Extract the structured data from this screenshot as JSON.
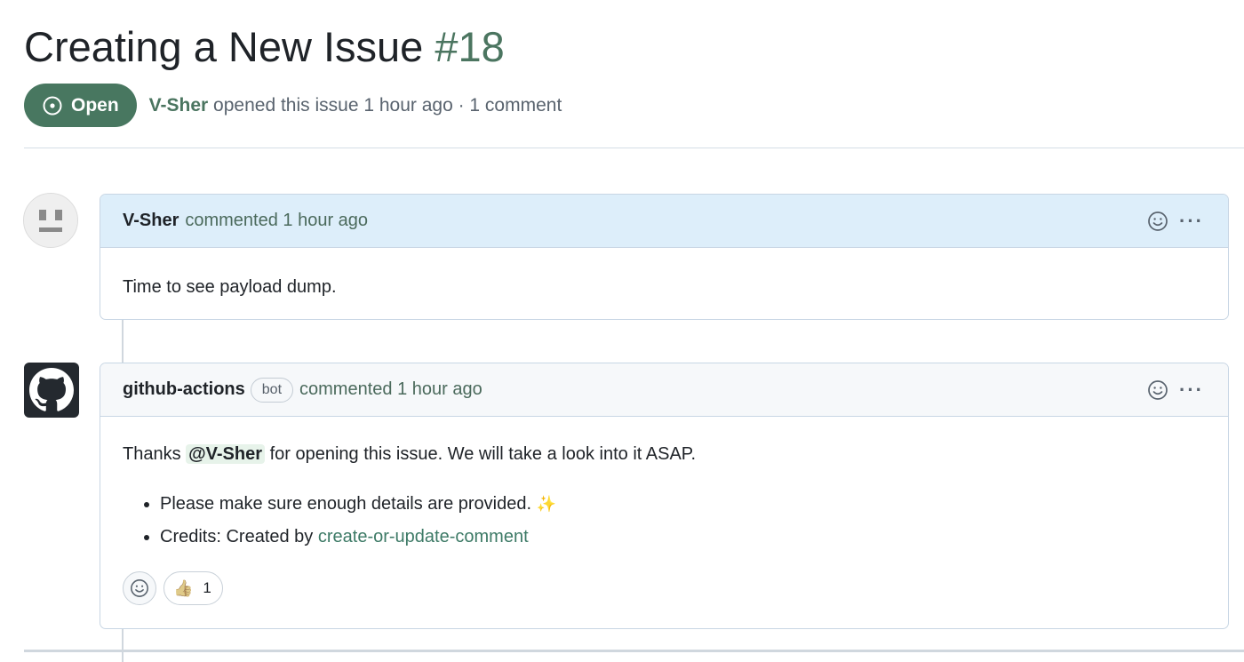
{
  "issue": {
    "title": "Creating a New Issue",
    "number": "#18",
    "state": "Open",
    "author": "V-Sher",
    "opened_text": "opened this issue 1 hour ago · 1 comment"
  },
  "colors": {
    "open_badge": "#487760",
    "link": "#3d7a66",
    "first_comment_header": "#ddeefa"
  },
  "comments": [
    {
      "author": "V-Sher",
      "timestamp": "commented 1 hour ago",
      "avatar_icon": "identicon-avatar",
      "body": "Time to see payload dump."
    },
    {
      "author": "github-actions",
      "bot_label": "bot",
      "timestamp": "commented 1 hour ago",
      "avatar_icon": "github-octocat-icon",
      "body_prefix": "Thanks ",
      "mention": "@V-Sher",
      "body_suffix": " for opening this issue. We will take a look into it ASAP.",
      "bullets": [
        {
          "text": "Please make sure enough details are provided. ",
          "emoji": "✨"
        },
        {
          "text": "Credits: Created by ",
          "link": "create-or-update-comment"
        }
      ],
      "reactions": [
        {
          "emoji": "👍",
          "count": "1"
        }
      ]
    }
  ],
  "icons": {
    "add_reaction": "smiley-icon",
    "more_options": "kebab-horizontal-icon",
    "state": "issue-open-icon"
  }
}
